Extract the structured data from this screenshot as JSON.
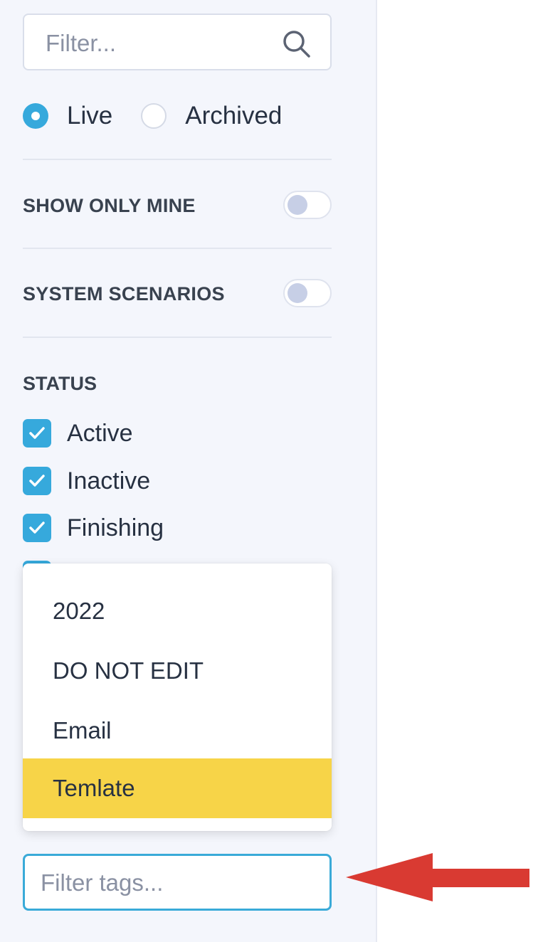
{
  "filter": {
    "placeholder": "Filter..."
  },
  "view_mode": {
    "options": [
      {
        "label": "Live",
        "selected": true
      },
      {
        "label": "Archived",
        "selected": false
      }
    ]
  },
  "toggles": {
    "show_only_mine": {
      "label": "SHOW ONLY MINE",
      "on": false
    },
    "system_scenarios": {
      "label": "SYSTEM SCENARIOS",
      "on": false
    }
  },
  "status": {
    "title": "STATUS",
    "items": [
      {
        "label": "Active",
        "checked": true
      },
      {
        "label": "Inactive",
        "checked": true
      },
      {
        "label": "Finishing",
        "checked": true
      }
    ]
  },
  "tags": {
    "input_placeholder": "Filter tags...",
    "dropdown_options": [
      "2022",
      "DO NOT EDIT",
      "Email",
      "Temlate"
    ],
    "highlighted_option": "Temlate"
  },
  "colors": {
    "accent": "#36a9dc",
    "highlight": "#f7d448",
    "sidebar_bg": "#f4f6fc",
    "annotation_arrow": "#d93a32"
  }
}
